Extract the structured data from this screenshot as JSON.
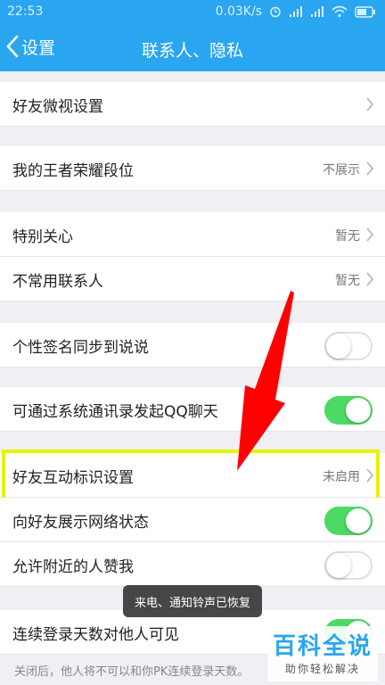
{
  "statusbar": {
    "time": "22:53",
    "speed": "0.03K/s"
  },
  "nav": {
    "back_label": "设置",
    "title": "联系人、隐私"
  },
  "rows": {
    "friend_micro": "好友微视设置",
    "honor_rank": {
      "label": "我的王者荣耀段位",
      "value": "不展示"
    },
    "special_care": {
      "label": "特别关心",
      "value": "暂无"
    },
    "rare_contacts": {
      "label": "不常用联系人",
      "value": "暂无"
    },
    "signature_sync": {
      "label": "个性签名同步到说说",
      "state": "off"
    },
    "qq_chat": {
      "label": "可通过系统通讯录发起QQ聊天",
      "state": "on"
    },
    "interaction_mark": {
      "label": "好友互动标识设置",
      "value": "未启用"
    },
    "network_status": {
      "label": "向好友展示网络状态",
      "state": "on"
    },
    "nearby_like": {
      "label": "允许附近的人赞我",
      "state": "off"
    },
    "login_days": {
      "label": "连续登录天数对他人可见",
      "state": "on"
    }
  },
  "toast": "来电、通知铃声已恢复",
  "footer_note": "关闭后，他人将不可以和你PK连续登录天数。",
  "watermark": {
    "title": "百科全说",
    "subtitle": "助你轻松解决"
  },
  "colors": {
    "accent": "#2aa6f0",
    "toggle_on": "#4cd964",
    "highlight": "#e8f300",
    "arrow": "#ff0000"
  }
}
